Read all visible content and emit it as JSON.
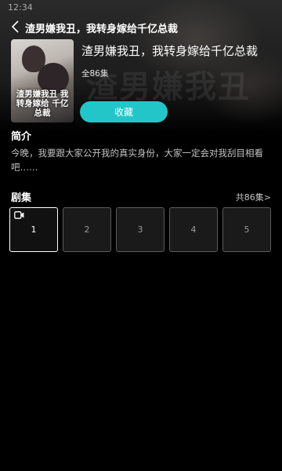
{
  "status": {
    "time": "12:34"
  },
  "header": {
    "title": "渣男嫌我丑，我转身嫁给千亿总裁"
  },
  "book": {
    "cover_text": "渣男嫌我丑 我转身嫁给 千亿总裁",
    "watermark": "渣男嫌我丑",
    "title": "渣男嫌我丑，我转身嫁给千亿总裁",
    "episode_count": "全86集",
    "collect_label": "收藏"
  },
  "intro": {
    "heading": "简介",
    "text": "今晚，我要跟大家公开我的真实身份，大家一定会对我刮目相看吧……"
  },
  "episodes_section": {
    "heading": "剧集",
    "more": "共86集>",
    "items": [
      "1",
      "2",
      "3",
      "4",
      "5"
    ]
  },
  "colors": {
    "accent": "#22c6c9",
    "background": "#000000"
  }
}
